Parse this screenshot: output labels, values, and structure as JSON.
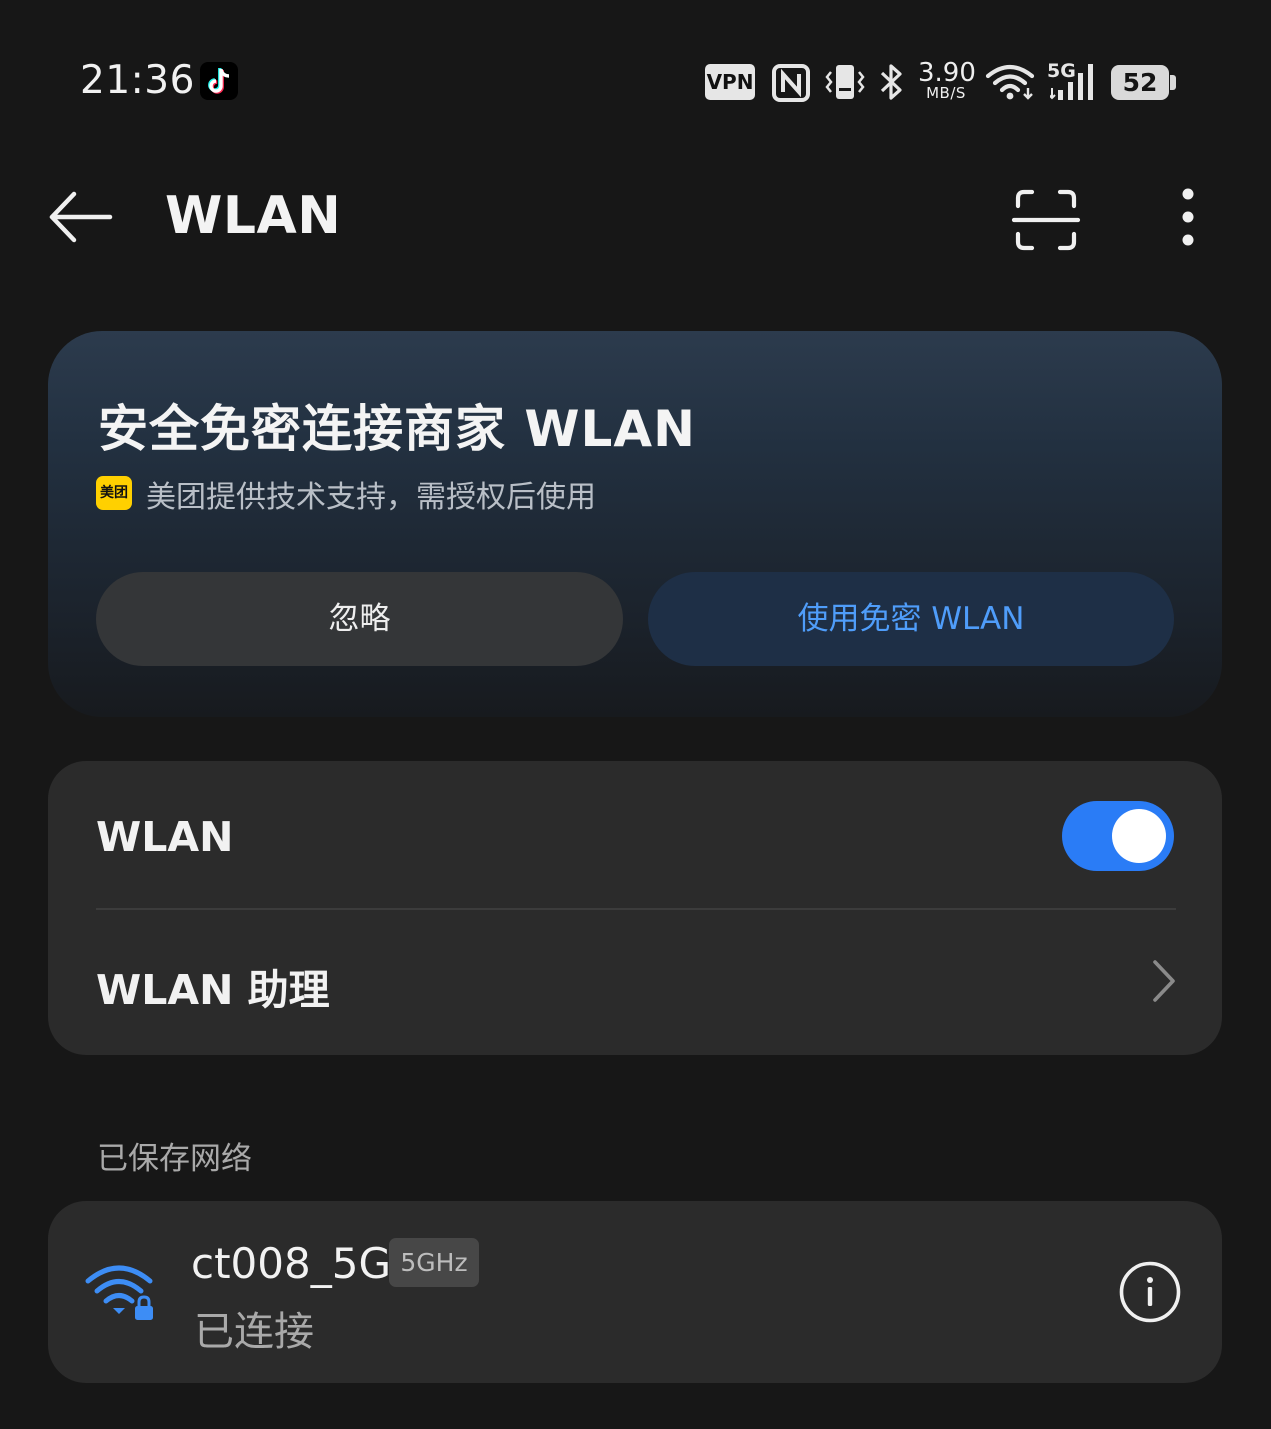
{
  "status_bar": {
    "time": "21:36",
    "vpn": "VPN",
    "speed_value": "3.90",
    "speed_unit": "MB/S",
    "network_type": "5G",
    "battery": "52",
    "icons": [
      "tiktok-icon",
      "vpn-icon",
      "nfc-icon",
      "vibrate-icon",
      "bluetooth-icon",
      "wifi-signal-icon",
      "cellular-signal-icon",
      "battery-icon"
    ]
  },
  "header": {
    "title": "WLAN",
    "icons": [
      "back-arrow-icon",
      "scan-icon",
      "more-vertical-icon"
    ]
  },
  "promo": {
    "title": "安全免密连接商家 WLAN",
    "logo_text": "美团",
    "subtitle": "美团提供技术支持，需授权后使用",
    "ignore_label": "忽略",
    "use_label": "使用免密 WLAN"
  },
  "settings": {
    "wlan_label": "WLAN",
    "wlan_enabled": true,
    "assistant_label": "WLAN 助理"
  },
  "saved_networks": {
    "section_label": "已保存网络",
    "items": [
      {
        "ssid": "ct008_5G",
        "band": "5GHz",
        "status": "已连接",
        "secured": true
      }
    ]
  },
  "colors": {
    "background": "#171717",
    "card": "#2b2b2b",
    "accent": "#2a7cf6",
    "accent_text": "#4f9dfa",
    "meituan_yellow": "#ffd000"
  }
}
